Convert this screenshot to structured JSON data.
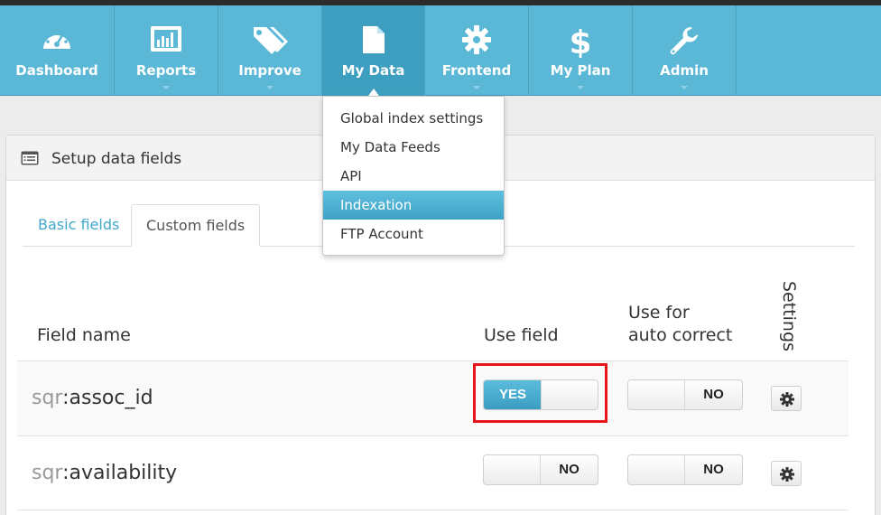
{
  "nav": {
    "items": [
      {
        "label": "Dashboard",
        "icon": "dashboard-gauge-icon"
      },
      {
        "label": "Reports",
        "icon": "bar-chart-icon"
      },
      {
        "label": "Improve",
        "icon": "tags-icon"
      },
      {
        "label": "My Data",
        "icon": "file-icon"
      },
      {
        "label": "Frontend",
        "icon": "gear-icon"
      },
      {
        "label": "My Plan",
        "icon": "dollar-icon"
      },
      {
        "label": "Admin",
        "icon": "wrench-icon"
      }
    ],
    "active": "My Data",
    "accent_color": "#5ab8d6",
    "active_color": "#3e9ebf"
  },
  "dropdown": {
    "items": [
      {
        "label": "Global index settings"
      },
      {
        "label": "My Data Feeds"
      },
      {
        "label": "API"
      },
      {
        "label": "Indexation"
      },
      {
        "label": "FTP Account"
      }
    ],
    "highlighted": "Indexation"
  },
  "panel": {
    "title": "Setup data fields",
    "tabs": [
      {
        "label": "Basic fields"
      },
      {
        "label": "Custom fields"
      }
    ],
    "active_tab": "Custom fields"
  },
  "table": {
    "headers": {
      "field_name": "Field name",
      "use_field": "Use field",
      "auto_correct_line1": "Use for",
      "auto_correct_line2": "auto correct",
      "settings": "Settings"
    },
    "rows": [
      {
        "prefix": "sqr",
        "name": ":assoc_id",
        "use_field": "YES",
        "auto_correct": "NO"
      },
      {
        "prefix": "sqr",
        "name": ":availability",
        "use_field": "NO",
        "auto_correct": "NO"
      }
    ]
  },
  "colors": {
    "toggle_on": "#4aaed1",
    "highlight_box": "#e8141c"
  }
}
